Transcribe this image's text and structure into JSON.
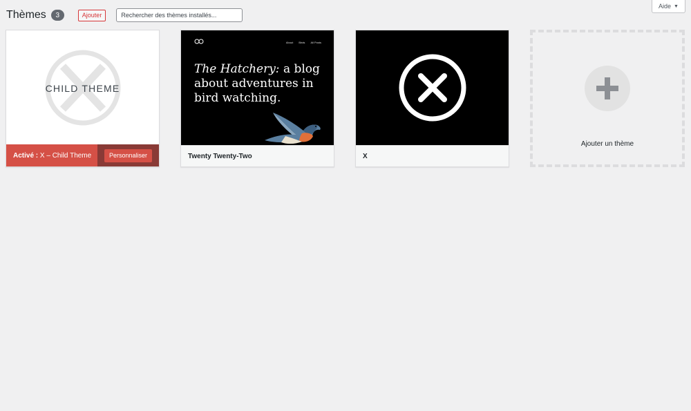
{
  "help": {
    "label": "Aide",
    "caret": "▼"
  },
  "header": {
    "title": "Thèmes",
    "count": "3",
    "add_label": "Ajouter",
    "search_placeholder": "Rechercher des thèmes installés..."
  },
  "themes": [
    {
      "screenshot_text": "CHILD THEME",
      "active_prefix": "Activé :",
      "name": "X – Child Theme",
      "customize_label": "Personnaliser"
    },
    {
      "name": "Twenty Twenty-Two",
      "nav": [
        "About",
        "Birds",
        "All Posts"
      ],
      "heading_italic": "The Hatchery:",
      "heading_rest": " a blog about adventures in bird watching."
    },
    {
      "name": "X"
    }
  ],
  "add_new": {
    "label": "Ajouter un thème"
  },
  "colors": {
    "accent": "#d63638",
    "active_footer": "#d55046",
    "active_customize_bg": "#893a36",
    "background": "#f0f0f1"
  },
  "icons": {
    "help_caret": "caret-down-icon",
    "child_x": "x-logo-icon",
    "tt2_logo": "infinity-logo-icon",
    "bird": "bird-illustration",
    "x_logo": "close-circle-icon",
    "plus": "plus-icon"
  }
}
